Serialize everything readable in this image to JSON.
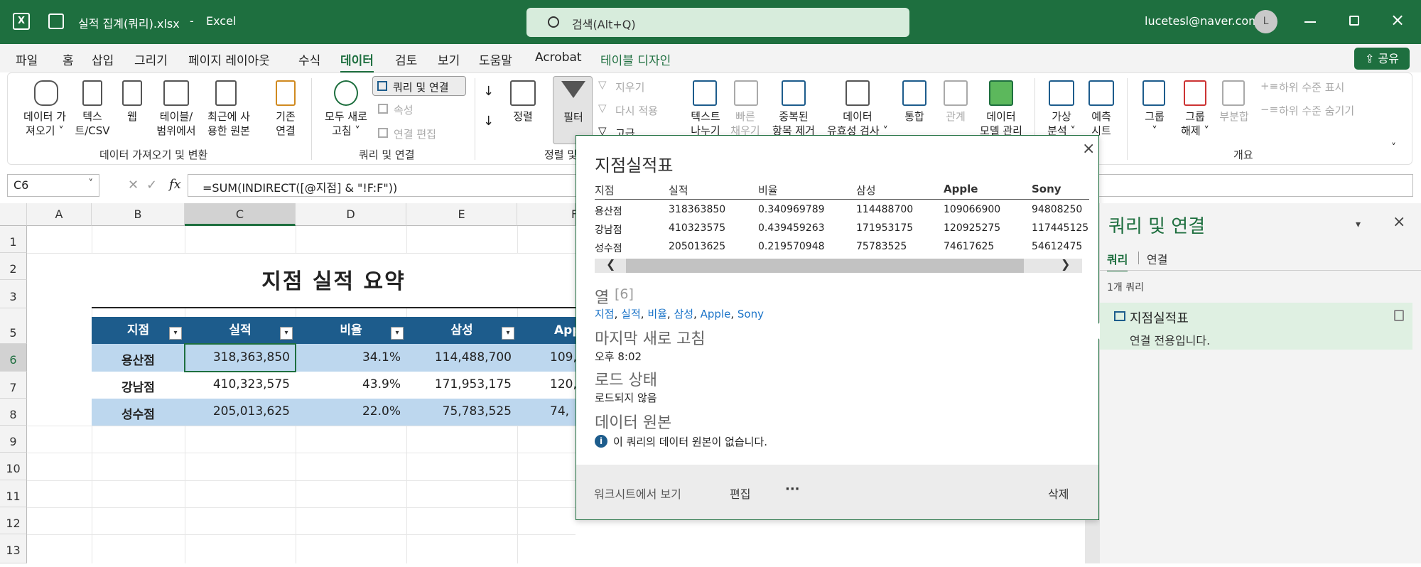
{
  "titlebar": {
    "filename": "실적 집계(쿼리).xlsx",
    "sep": "-",
    "app": "Excel",
    "search_placeholder": "검색(Alt+Q)",
    "user_email": "lucetesl@naver.com",
    "avatar_letter": "L"
  },
  "tabs": [
    "파일",
    "홈",
    "삽입",
    "그리기",
    "페이지 레이아웃",
    "수식",
    "데이터",
    "검토",
    "보기",
    "도움말",
    "Acrobat",
    "테이블 디자인"
  ],
  "share": "공유",
  "ribbon": {
    "get_data": "데이터 가\n져오기 ˅",
    "text_csv": "텍스\n트/CSV",
    "web": "웹",
    "from_table": "테이블/\n범위에서",
    "recent_sources": "최근에 사\n용한 원본",
    "existing_conn": "기존\n연결",
    "group_get": "데이터 가져오기 및 변환",
    "refresh_all": "모두 새로\n고침 ˅",
    "queries_conn": "쿼리 및 연결",
    "properties": "속성",
    "edit_links": "연결 편집",
    "group_query": "쿼리 및 연결",
    "sort": "정렬",
    "filter": "필터",
    "clear": "지우기",
    "reapply": "다시 적용",
    "advanced": "고급",
    "group_sort": "정렬 및",
    "text_to_cols": "텍스트\n나누기",
    "flash_fill": "빠른\n채우기",
    "remove_dup": "중복된\n항목 제거",
    "data_validation": "데이터\n유효성 검사 ˅",
    "consolidate": "통합",
    "relationships": "관계",
    "data_model": "데이터\n모델 관리",
    "whatif": "가상\n분석 ˅",
    "forecast": "예측\n시트",
    "group": "그룹\n˅",
    "ungroup": "그룹\n해제 ˅",
    "subtotal": "부분합",
    "show_detail": "하위 수준 표시",
    "hide_detail": "하위 수준 숨기기",
    "group_outline": "개요"
  },
  "formula_bar": {
    "name_box": "C6",
    "fx": "fx",
    "formula": "=SUM(INDIRECT([@지점] & \"!F:F\"))"
  },
  "columns": [
    "A",
    "B",
    "C",
    "D",
    "E",
    "F"
  ],
  "rows": [
    "1",
    "2",
    "3",
    "5",
    "6",
    "7",
    "8",
    "9",
    "10",
    "11",
    "12",
    "13"
  ],
  "sheet": {
    "title": "지점 실적 요약",
    "headers": [
      "지점",
      "실적",
      "비율",
      "삼성",
      "App"
    ],
    "data": [
      [
        "용산점",
        "318,363,850",
        "34.1%",
        "114,488,700",
        "109,"
      ],
      [
        "강남점",
        "410,323,575",
        "43.9%",
        "171,953,175",
        "120,"
      ],
      [
        "성수점",
        "205,013,625",
        "22.0%",
        "75,783,525",
        "74,"
      ]
    ]
  },
  "popup": {
    "title": "지점실적표",
    "close": "×",
    "headers": [
      "지점",
      "실적",
      "비율",
      "삼성",
      "Apple",
      "Sony"
    ],
    "rows": [
      [
        "용산점",
        "318363850",
        "0.340969789",
        "114488700",
        "109066900",
        "94808250"
      ],
      [
        "강남점",
        "410323575",
        "0.439459263",
        "171953175",
        "120925275",
        "117445125"
      ],
      [
        "성수점",
        "205013625",
        "0.219570948",
        "75783525",
        "74617625",
        "54612475"
      ]
    ],
    "columns_label": "열",
    "columns_count": "[6]",
    "columns_list": [
      "지점",
      "실적",
      "비율",
      "삼성",
      "Apple",
      "Sony"
    ],
    "last_refresh_label": "마지막 새로 고침",
    "last_refresh": "오후 8:02",
    "load_status_label": "로드 상태",
    "load_status": "로드되지 않음",
    "source_label": "데이터 원본",
    "source_info": "이 쿼리의 데이터 원본이 없습니다.",
    "view_in_sheet": "워크시트에서 보기",
    "edit": "편집",
    "more": "···",
    "delete": "삭제"
  },
  "queries_panel": {
    "title": "쿼리 및 연결",
    "tab_queries": "쿼리",
    "tab_connections": "연결",
    "count": "1개 쿼리",
    "query_name": "지점실적표",
    "query_desc": "연결 전용입니다."
  }
}
